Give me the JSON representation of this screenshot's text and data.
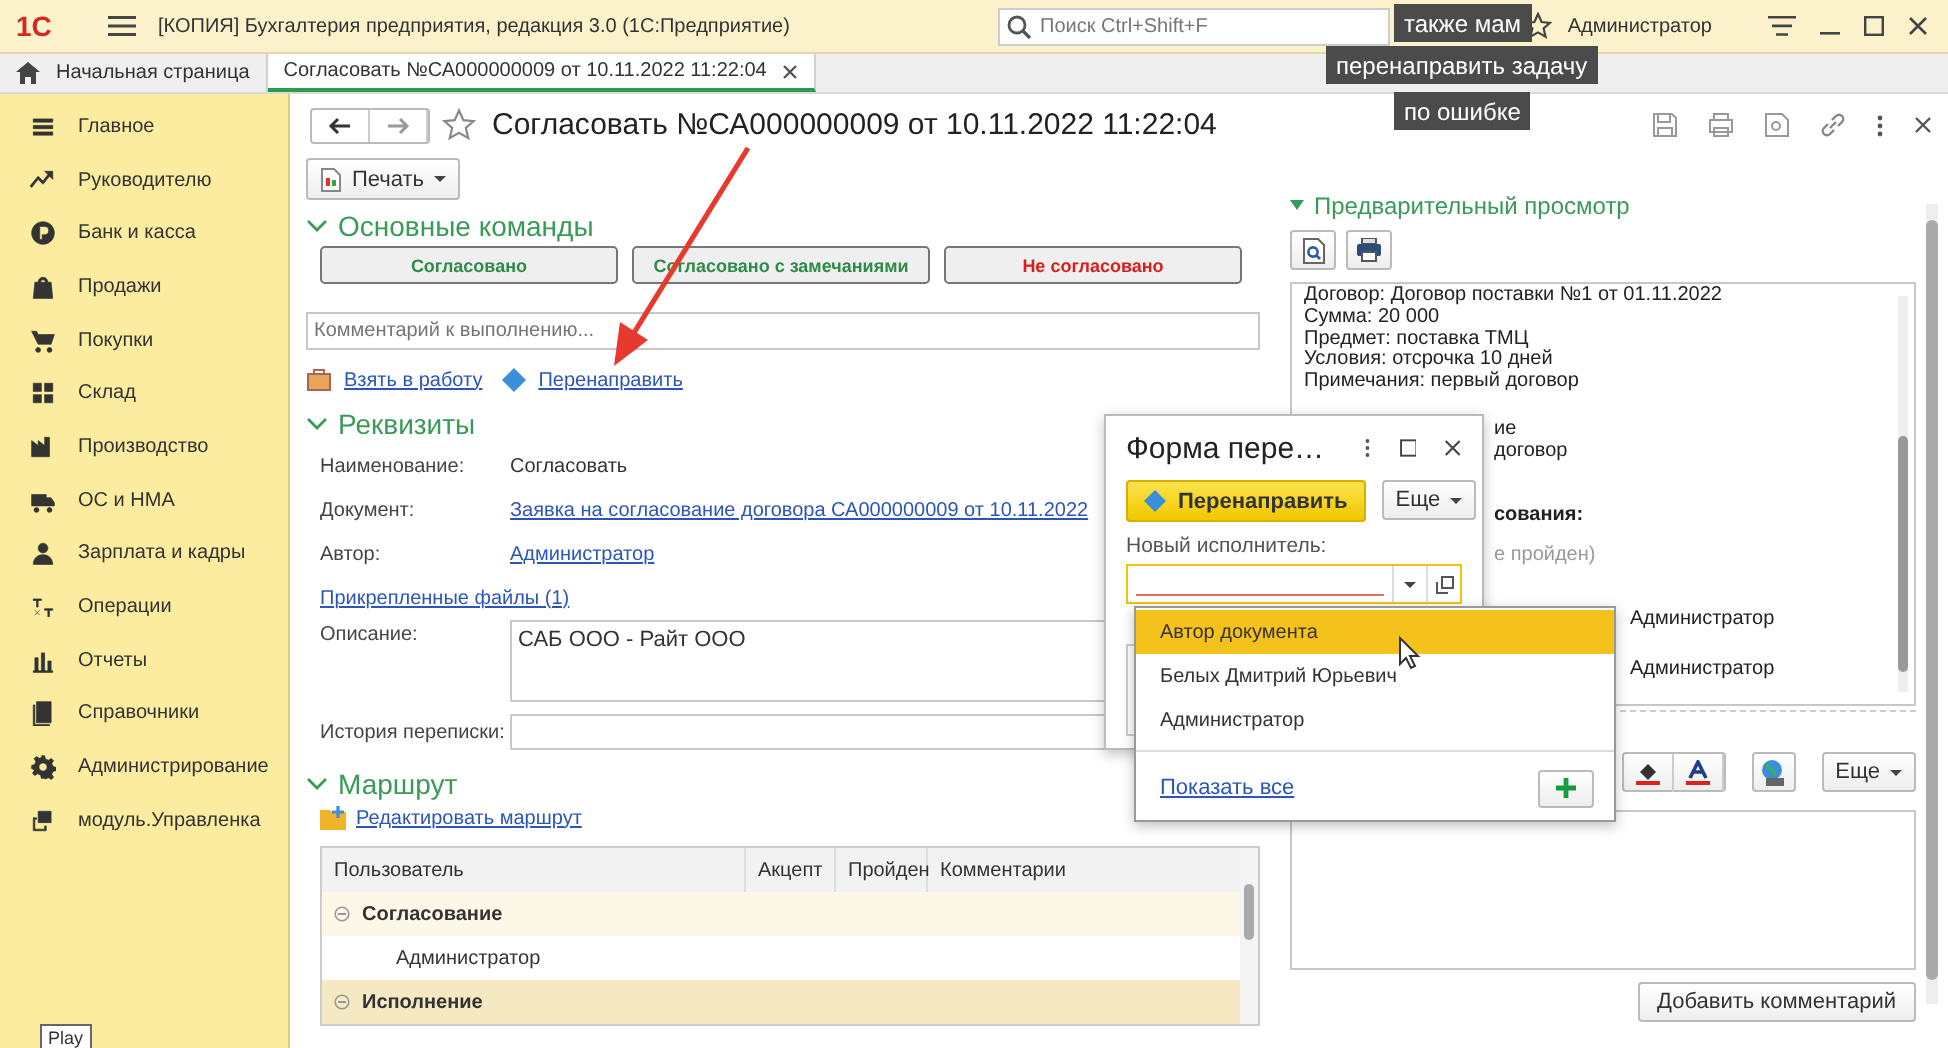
{
  "app_bar": {
    "logo": "1С",
    "title": "[КОПИЯ] Бухгалтерия предприятия, редакция 3.0  (1С:Предприятие)",
    "search": {
      "placeholder": "Поиск Ctrl+Shift+F"
    },
    "user": "Администратор"
  },
  "tabs": [
    {
      "label": "Начальная страница",
      "kind": "home",
      "selected": false
    },
    {
      "label": "Согласовать №СА000000009 от 10.11.2022 11:22:04",
      "kind": "document",
      "selected": true
    }
  ],
  "sidebar": {
    "items": [
      {
        "label": "Главное"
      },
      {
        "label": "Руководителю"
      },
      {
        "label": "Банк и касса"
      },
      {
        "label": "Продажи"
      },
      {
        "label": "Покупки"
      },
      {
        "label": "Склад"
      },
      {
        "label": "Производство"
      },
      {
        "label": "ОС и НМА"
      },
      {
        "label": "Зарплата и кадры"
      },
      {
        "label": "Операции"
      },
      {
        "label": "Отчеты"
      },
      {
        "label": "Справочники"
      },
      {
        "label": "Администрирование"
      },
      {
        "label": "модуль.Управленка"
      }
    ]
  },
  "form": {
    "title": "Согласовать №СА000000009 от 10.11.2022 11:22:04",
    "print_button": "Печать",
    "main_commands": {
      "title": "Основные команды",
      "expanded": true,
      "buttons": [
        {
          "label": "Согласовано",
          "kind": "approve"
        },
        {
          "label": "Согласовано с замечаниями",
          "kind": "approve"
        },
        {
          "label": "Не согласовано",
          "kind": "reject"
        }
      ]
    },
    "comment": {
      "placeholder": "Комментарий к выполнению..."
    },
    "actions": [
      {
        "label": "Взять в работу",
        "kind": "take"
      },
      {
        "label": "Перенаправить",
        "kind": "redirect"
      }
    ],
    "details": {
      "title": "Реквизиты",
      "expanded": true,
      "name_label": "Наименование:",
      "name": "Согласовать",
      "document_label": "Документ:",
      "document": "Заявка на согласование договора СА000000009 от 10.11.2022",
      "author_label": "Автор:",
      "author": "Администратор",
      "files": "Прикрепленные файлы (1)",
      "description_label": "Описание:",
      "description": "САБ ООО - Райт ООО",
      "history_label": "История переписки:"
    },
    "route": {
      "title": "Маршрут",
      "expanded": true,
      "edit_link": "Редактировать маршрут",
      "columns": [
        "Пользователь",
        "Акцепт",
        "Пройден",
        "Комментарии"
      ],
      "rows": [
        {
          "label": "Согласование",
          "expanded": true,
          "selected": false,
          "children": [
            {
              "label": "Администратор",
              "selected": false
            }
          ]
        },
        {
          "label": "Исполнение",
          "expanded": true,
          "selected": true
        }
      ]
    },
    "preview": {
      "title": "Предварительный просмотр",
      "expanded": true,
      "lines": [
        "Договор: Договор поставки №1 от 01.11.2022",
        "Сумма: 20 000",
        "Предмет: поставка ТМЦ",
        "Условия: отсрочка 10 дней",
        "Примечания: первый договор"
      ],
      "fragments": [
        {
          "text": "ие",
          "kind": "plain"
        },
        {
          "text": "договор",
          "kind": "plain"
        },
        {
          "text": "сования:",
          "kind": "heading"
        },
        {
          "text": "е пройден)",
          "kind": "muted"
        }
      ],
      "lower_fragments": [
        "Администратор",
        "Администратор"
      ]
    },
    "more_button": "Еще",
    "add_comment_button": "Добавить комментарий"
  },
  "redirect_dialog": {
    "title": "Форма пере…",
    "submit_button": "Перенаправить",
    "more_button": "Еще",
    "executor_label": "Новый исполнитель:",
    "executor_invalid": true,
    "dropdown": {
      "options": [
        {
          "label": "Автор документа",
          "selected": true
        },
        {
          "label": "Белых Дмитрий Юрьевич",
          "selected": false
        },
        {
          "label": "Администратор",
          "selected": false
        }
      ],
      "show_all": "Показать все"
    }
  },
  "video_captions": [
    "также мам",
    "перенаправить задачу",
    "по ошибке"
  ],
  "play_tooltip": "Play"
}
